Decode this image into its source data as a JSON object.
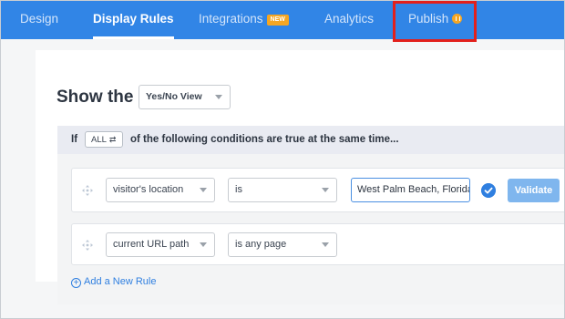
{
  "nav": {
    "tabs": [
      {
        "label": "Design"
      },
      {
        "label": "Display Rules",
        "active": true
      },
      {
        "label": "Integrations",
        "badge": "NEW"
      },
      {
        "label": "Analytics"
      },
      {
        "label": "Publish",
        "badge_icon": "pause-icon"
      }
    ]
  },
  "show": {
    "label": "Show the",
    "view_value": "Yes/No View"
  },
  "conditions": {
    "if_label": "If",
    "match_value": "ALL",
    "match_icon": "⇄",
    "text": "of the following conditions are true at the same time..."
  },
  "rules": [
    {
      "field": "visitor's location",
      "operator": "is",
      "value": "West Palm Beach, Florida",
      "validate_label": "Validate"
    },
    {
      "field": "current URL path",
      "operator": "is any page"
    }
  ],
  "add_rule_label": "Add a New Rule",
  "colors": {
    "nav_bg": "#3185e6",
    "accent": "#2f7fe0",
    "badge": "#f5a623",
    "highlight": "#e2201c"
  }
}
